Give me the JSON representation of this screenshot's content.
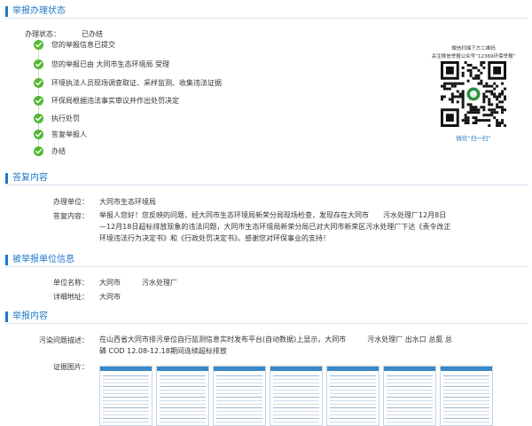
{
  "sections": {
    "process": "举报办理状态",
    "reply": "答复内容",
    "unit": "被举报单位信息",
    "report": "举报内容"
  },
  "status": {
    "label": "办理状态：",
    "value": "已办结"
  },
  "steps": [
    "您的举报信息已提交",
    "您的举报已由 大同市生态环境局 受理",
    "环境执法人员现场调查取证、采样监测、收集违法证据",
    "环保局根据违法事实审议并作出处罚决定",
    "执行处罚",
    "答复举报人",
    "办结"
  ],
  "qr": {
    "caption1": "微信扫描下方二维码",
    "caption2": "关注微信举报公众号“12369环保举报”",
    "caption3": "微信“扫一扫”"
  },
  "reply": {
    "unit_label": "办理单位：",
    "unit_value": "大同市生态环境局",
    "content_label": "答复内容：",
    "content_lines": [
      "举报人您好！您反映的问题，经大同市生态环境局新荣分局现场检查，发现存在大同市　　污水处理厂12月8日",
      "—12月18日超标排放现象的违法问题，大同市生态环境局新荣分局已对大同市新荣区污水处理厂下达《责令改正",
      "环境违法行为决定书》和《行政处罚决定书》。感谢您对环保事业的支持！"
    ]
  },
  "unit": {
    "name_label": "单位名称：",
    "name_value": "大同市　　　污水处理厂",
    "addr_label": "详细地址：",
    "addr_value": "大同市"
  },
  "report": {
    "desc_label": "污染问题描述：",
    "desc_lines": [
      "在山西省大同市排污单位自行监测信息实时发布平台(自动数据)上显示，大同市　　　污水处理厂 出水口 总氮 总",
      "磷 COD 12.08-12.18期间连续超标排放"
    ],
    "evidence_label": "证据图片："
  },
  "colors": {
    "accent": "#1f78c8",
    "check": "#53b833"
  }
}
